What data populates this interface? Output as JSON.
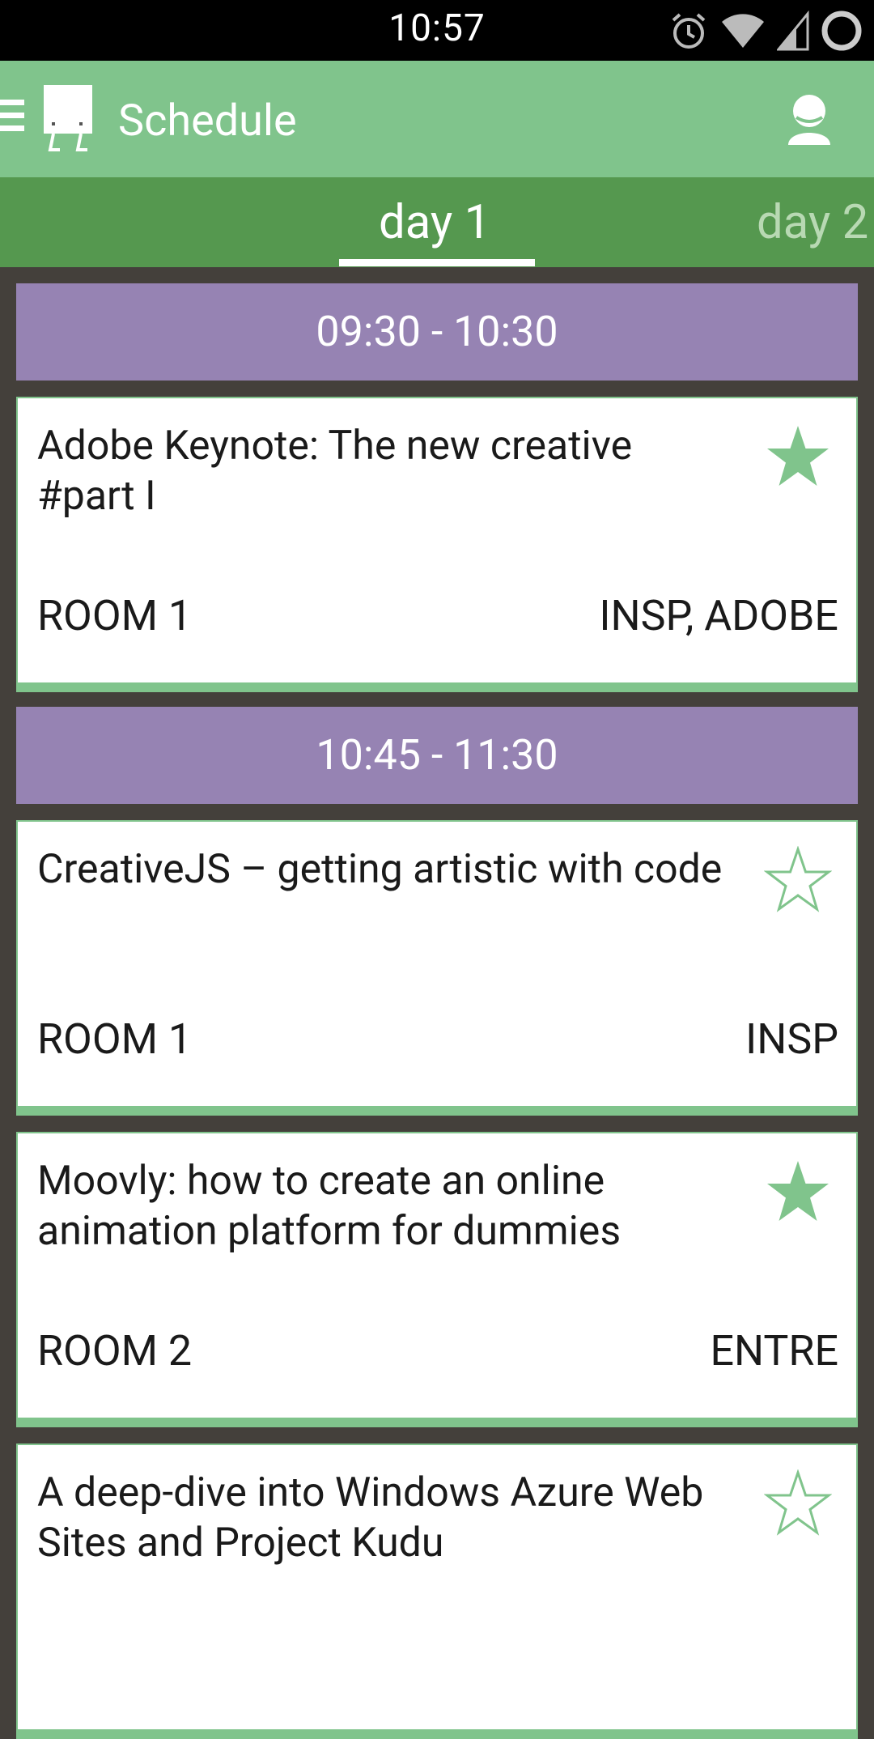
{
  "status_bar": {
    "time": "10:57"
  },
  "app_bar": {
    "title": "Schedule"
  },
  "tabs": [
    {
      "label": "day 1",
      "selected": true
    },
    {
      "label": "day 2",
      "selected": false
    }
  ],
  "colors": {
    "primary": "#80c48c",
    "tab_bar": "#55984f",
    "time_header": "#9683b3",
    "background": "#44403b"
  },
  "schedule": {
    "slots": [
      {
        "time": "09:30 - 10:30",
        "sessions": [
          {
            "title": "Adobe Keynote: The new creative #part I",
            "room": "ROOM 1",
            "tracks": "INSP, ADOBE",
            "starred": true
          }
        ]
      },
      {
        "time": "10:45 - 11:30",
        "sessions": [
          {
            "title": "CreativeJS – getting artistic with code",
            "room": "ROOM 1",
            "tracks": "INSP",
            "starred": false
          },
          {
            "title": "Moovly: how to create an online animation platform for dummies",
            "room": "ROOM 2",
            "tracks": "ENTRE",
            "starred": true
          },
          {
            "title": "A deep-dive into Windows Azure Web Sites and Project Kudu",
            "room": "",
            "tracks": "",
            "starred": false
          }
        ]
      }
    ]
  }
}
